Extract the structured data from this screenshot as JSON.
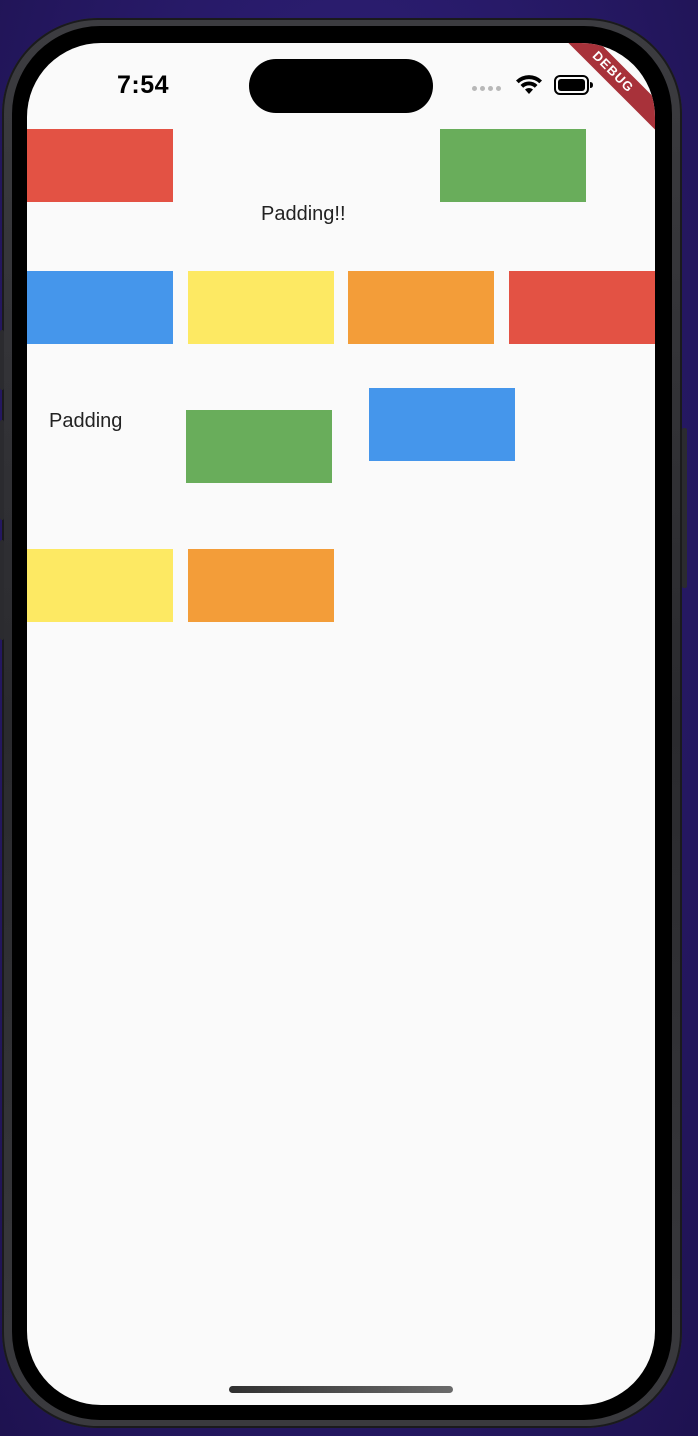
{
  "status_bar": {
    "time": "7:54"
  },
  "debug_banner": {
    "label": "DEBUG"
  },
  "labels": {
    "padding_bang": "Padding!!",
    "padding": "Padding"
  },
  "colors": {
    "red": "#e35244",
    "green": "#69ad5b",
    "blue": "#4596eb",
    "yellow": "#fde963",
    "orange": "#f39d39",
    "background": "#fafafa",
    "debug_banner": "#a8323a"
  },
  "boxes": [
    {
      "name": "red-box-1",
      "color": "red"
    },
    {
      "name": "green-box-1",
      "color": "green"
    },
    {
      "name": "blue-box-1",
      "color": "blue"
    },
    {
      "name": "yellow-box-1",
      "color": "yellow"
    },
    {
      "name": "orange-box-1",
      "color": "orange"
    },
    {
      "name": "red-box-2",
      "color": "red"
    },
    {
      "name": "green-box-2",
      "color": "green"
    },
    {
      "name": "blue-box-2",
      "color": "blue"
    },
    {
      "name": "yellow-box-2",
      "color": "yellow"
    },
    {
      "name": "orange-box-2",
      "color": "orange"
    }
  ]
}
